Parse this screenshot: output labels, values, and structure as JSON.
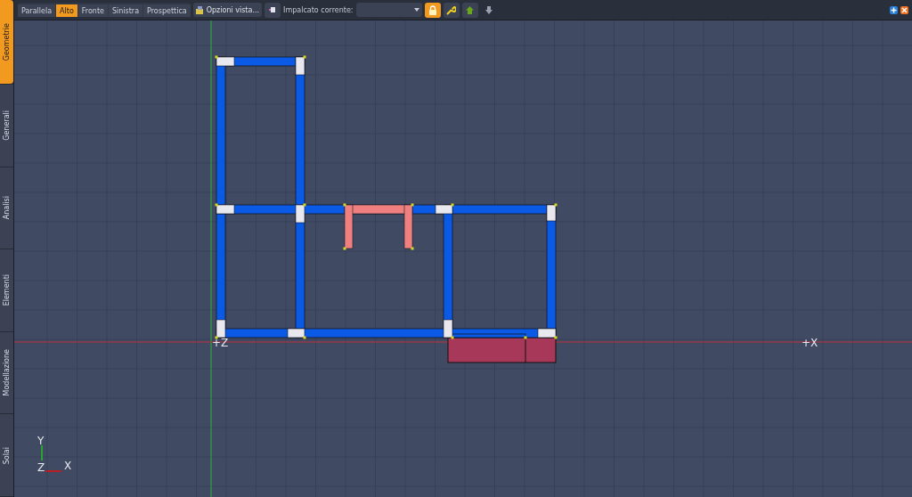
{
  "side_tabs": [
    {
      "label": "Geometrie",
      "selected": true
    },
    {
      "label": "Generali",
      "selected": false
    },
    {
      "label": "Analisi",
      "selected": false
    },
    {
      "label": "Elementi",
      "selected": false
    },
    {
      "label": "Modellazione",
      "selected": false
    },
    {
      "label": "Solai",
      "selected": false
    }
  ],
  "view_tabs": [
    {
      "label": "Parallela",
      "selected": false
    },
    {
      "label": "Alto",
      "selected": true
    },
    {
      "label": "Fronte",
      "selected": false
    },
    {
      "label": "Sinistra",
      "selected": false
    },
    {
      "label": "Prospettica",
      "selected": false
    }
  ],
  "view_options_button": "Opzioni vista...",
  "floor_label": "Impalcato corrente:",
  "lock_on": true,
  "canvas": {
    "origin_label": "+Z",
    "x_label": "+X",
    "triad": {
      "y": "Y",
      "z": "Z",
      "x": "X"
    }
  }
}
